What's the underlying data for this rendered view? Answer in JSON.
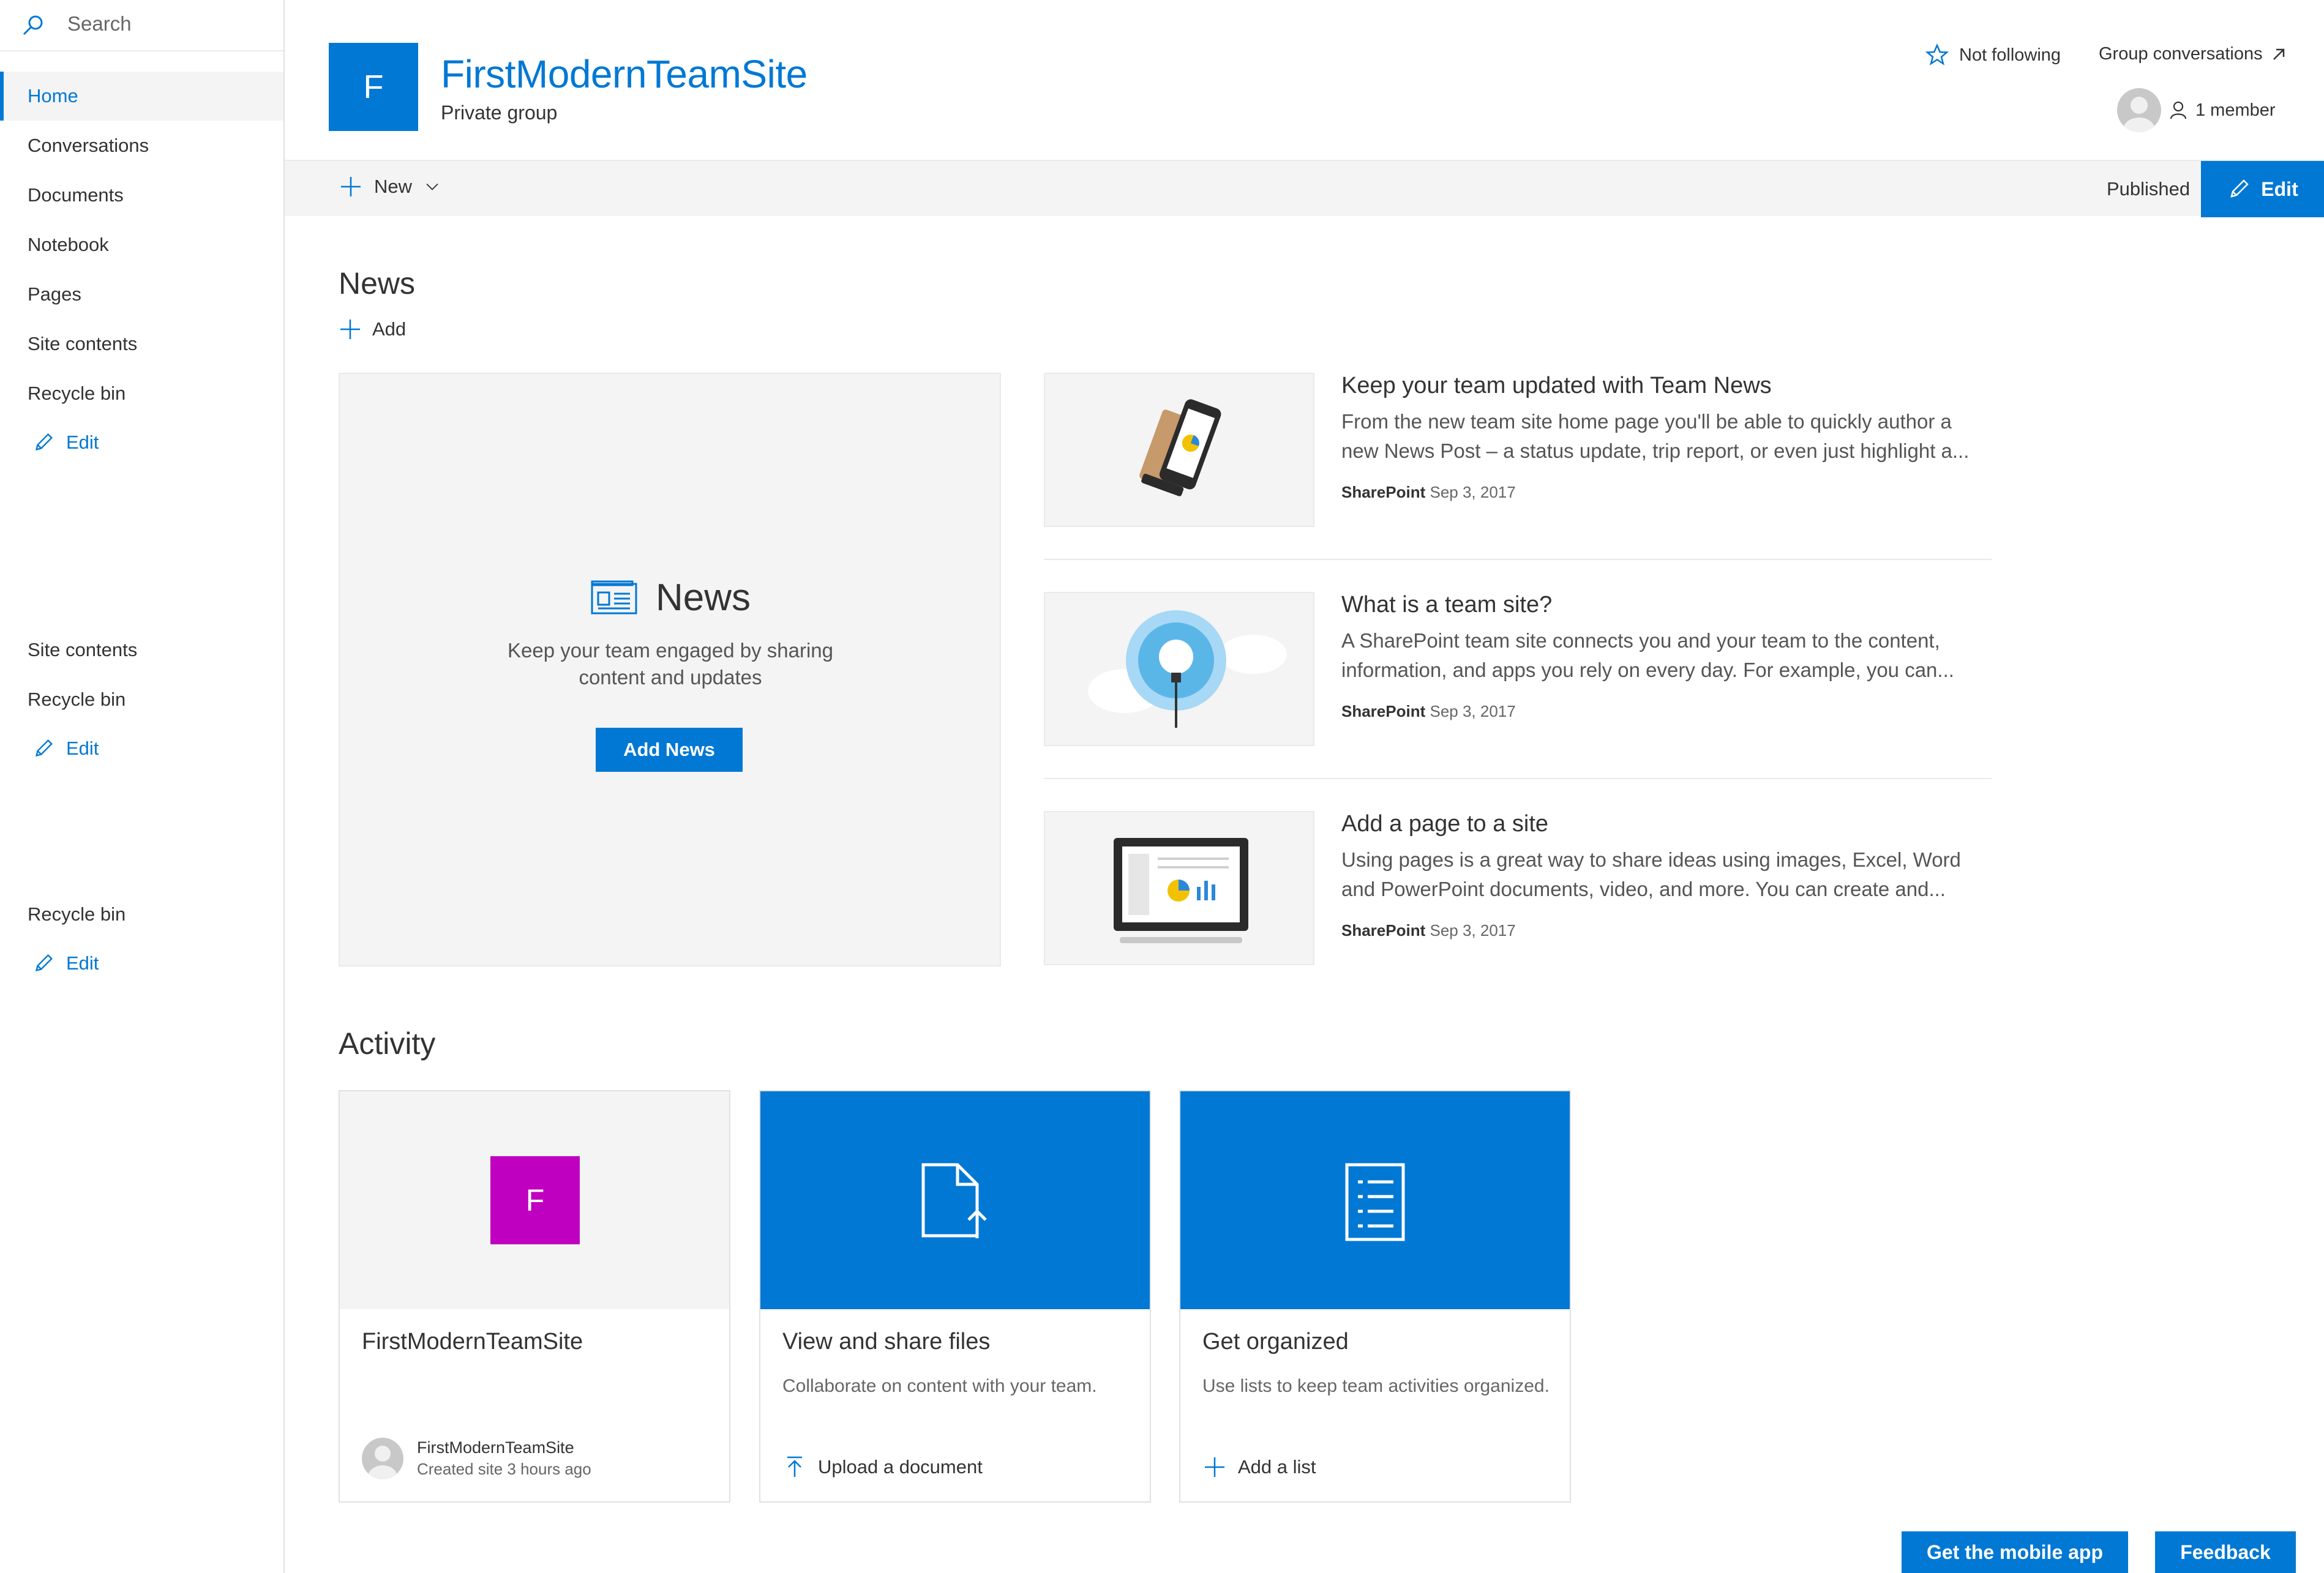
{
  "search": {
    "placeholder": "Search"
  },
  "nav": {
    "home": "Home",
    "conversations": "Conversations",
    "documents": "Documents",
    "notebook": "Notebook",
    "pages": "Pages",
    "site_contents": "Site contents",
    "recycle_bin": "Recycle bin",
    "edit": "Edit",
    "group2": {
      "site_contents": "Site contents",
      "recycle_bin": "Recycle bin",
      "edit": "Edit"
    },
    "group3": {
      "recycle_bin": "Recycle bin",
      "edit": "Edit"
    }
  },
  "header": {
    "logo_letter": "F",
    "site_title": "FirstModernTeamSite",
    "site_subtitle": "Private group",
    "not_following": "Not following",
    "group_conversations": "Group conversations",
    "members": "1 member"
  },
  "commandbar": {
    "new": "New",
    "status": "Published",
    "edit": "Edit"
  },
  "news": {
    "title": "News",
    "add": "Add",
    "hero": {
      "heading": "News",
      "text": "Keep your team engaged by sharing content and updates",
      "button": "Add News"
    },
    "items": [
      {
        "title": "Keep your team updated with Team News",
        "desc": "From the new team site home page you'll be able to quickly author a new News Post – a status update, trip report, or even just highlight a...",
        "author": "SharePoint",
        "date": "Sep 3, 2017"
      },
      {
        "title": "What is a team site?",
        "desc": "A SharePoint team site connects you and your team to the content, information, and apps you rely on every day. For example, you can...",
        "author": "SharePoint",
        "date": "Sep 3, 2017"
      },
      {
        "title": "Add a page to a site",
        "desc": "Using pages is a great way to share ideas using images, Excel, Word and PowerPoint documents, video, and more. You can create and...",
        "author": "SharePoint",
        "date": "Sep 3, 2017"
      }
    ]
  },
  "activity": {
    "title": "Activity",
    "cards": [
      {
        "tile_letter": "F",
        "title": "FirstModernTeamSite",
        "creator": "FirstModernTeamSite",
        "created": "Created site 3 hours ago"
      },
      {
        "title": "View and share files",
        "desc": "Collaborate on content with your team.",
        "action": "Upload a document"
      },
      {
        "title": "Get organized",
        "desc": "Use lists to keep team activities organized.",
        "action": "Add a list"
      }
    ]
  },
  "footer": {
    "mobile_app": "Get the mobile app",
    "feedback": "Feedback"
  },
  "colors": {
    "accent": "#0078d4",
    "tile_magenta": "#c000c0",
    "panel_gray": "#f4f4f4"
  }
}
